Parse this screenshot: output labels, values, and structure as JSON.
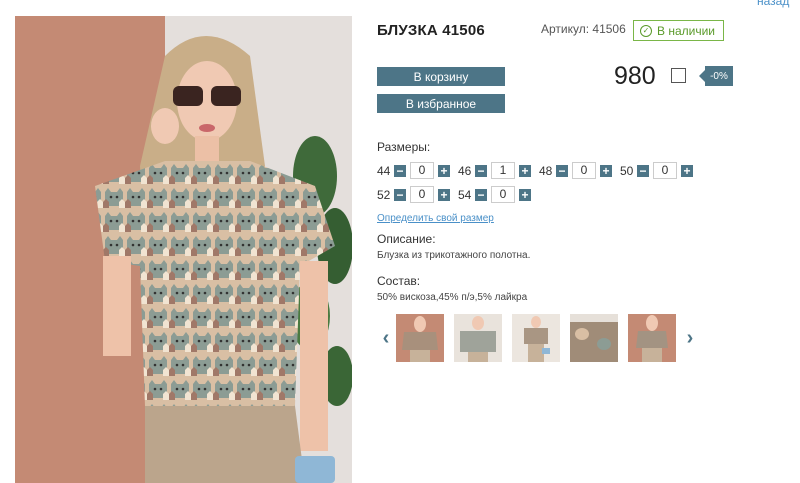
{
  "nav": {
    "back_label": "назад"
  },
  "product": {
    "title": "БЛУЗКА 41506",
    "sku": "Артикул: 41506",
    "stock": "В наличии",
    "cart_button": "В корзину",
    "fav_button": "В избранное",
    "price": "980",
    "discount": "-0%"
  },
  "sizes": {
    "label": "Размеры:",
    "items": [
      {
        "size": "44",
        "qty": "0"
      },
      {
        "size": "46",
        "qty": "1"
      },
      {
        "size": "48",
        "qty": "0"
      },
      {
        "size": "50",
        "qty": "0"
      },
      {
        "size": "52",
        "qty": "0"
      },
      {
        "size": "54",
        "qty": "0"
      }
    ],
    "link": "Определить свой размер"
  },
  "description": {
    "label": "Описание:",
    "text": "Блузка из трикотажного полотна."
  },
  "composition": {
    "label": "Состав:",
    "text": "50% вискоза,45% п/э,5% лайкра"
  },
  "icons": {
    "minus": "−",
    "plus": "+",
    "prev": "‹",
    "next": "›",
    "check": "✓"
  },
  "colors": {
    "accent": "#4d7587",
    "stock_green": "#5a9a2a",
    "link": "#4a90c8"
  }
}
